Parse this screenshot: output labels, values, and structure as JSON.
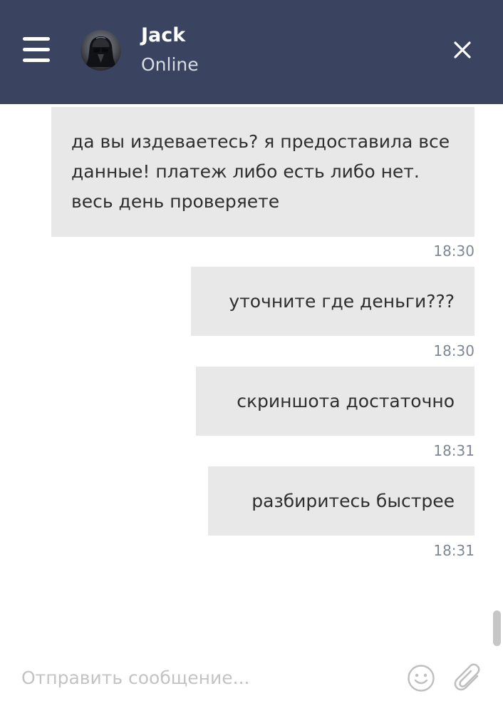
{
  "header": {
    "menu_icon": "hamburger-menu-icon",
    "contact_name": "Jack",
    "contact_status": "Online",
    "close_icon": "close-icon"
  },
  "messages": [
    {
      "text": "да вы издеваетесь? я предоставила все данные! платеж либо есть либо нет. весь день проверяете",
      "time": "18:30"
    },
    {
      "text": "уточните где деньги???",
      "time": "18:30"
    },
    {
      "text": "скриншота достаточно",
      "time": "18:31"
    },
    {
      "text": "разбиритесь быстрее",
      "time": "18:31"
    }
  ],
  "composer": {
    "placeholder": "Отправить сообщение...",
    "value": "",
    "emoji_icon": "emoji-icon",
    "attach_icon": "paperclip-icon"
  },
  "colors": {
    "header_bg": "#3a4461",
    "bubble_bg": "#e8e8e8",
    "time_text": "#7f8796",
    "placeholder_text": "#c3c3c3"
  }
}
